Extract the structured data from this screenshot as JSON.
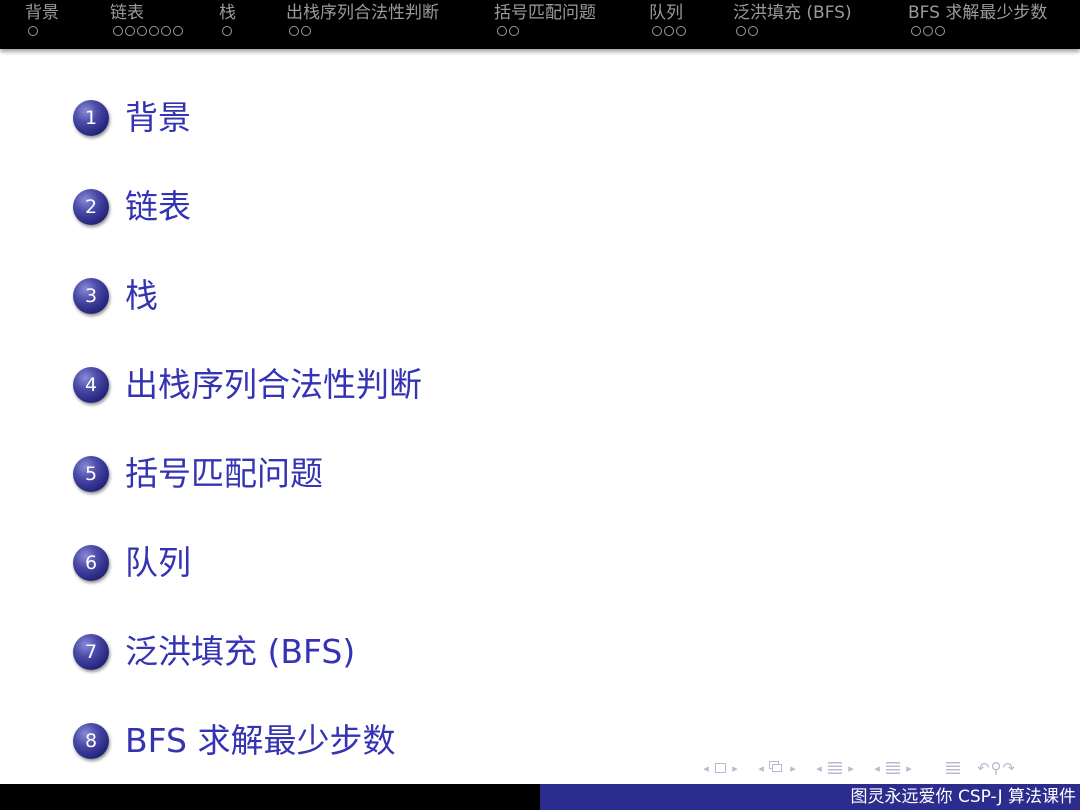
{
  "nav": {
    "sections": [
      {
        "title": "背景",
        "dots": 1
      },
      {
        "title": "链表",
        "dots": 6
      },
      {
        "title": "栈",
        "dots": 1
      },
      {
        "title": "出栈序列合法性判断",
        "dots": 2
      },
      {
        "title": "括号匹配问题",
        "dots": 2
      },
      {
        "title": "队列",
        "dots": 3
      },
      {
        "title": "泛洪填充 (BFS)",
        "dots": 2
      },
      {
        "title": "BFS 求解最少步数",
        "dots": 3
      }
    ]
  },
  "outline": {
    "items": [
      {
        "number": "1",
        "label": "背景"
      },
      {
        "number": "2",
        "label": "链表"
      },
      {
        "number": "3",
        "label": "栈"
      },
      {
        "number": "4",
        "label": "出栈序列合法性判断"
      },
      {
        "number": "5",
        "label": "括号匹配问题"
      },
      {
        "number": "6",
        "label": "队列"
      },
      {
        "number": "7",
        "label": "泛洪填充 (BFS)"
      },
      {
        "number": "8",
        "label": "BFS 求解最少步数"
      }
    ]
  },
  "footer": {
    "right_text": "图灵永远爱你 CSP-J 算法课件"
  },
  "colors": {
    "accent": "#3333b3",
    "footer_blue": "#2c2c8e",
    "bar_black": "#000000",
    "nav_gray": "#9a9a9a"
  },
  "icons": {
    "navigation_symbols": [
      "prev-icon",
      "slide-icon",
      "next-icon",
      "frame-icon",
      "subsection-icon",
      "section-icon",
      "align-icon",
      "search-icon"
    ]
  }
}
